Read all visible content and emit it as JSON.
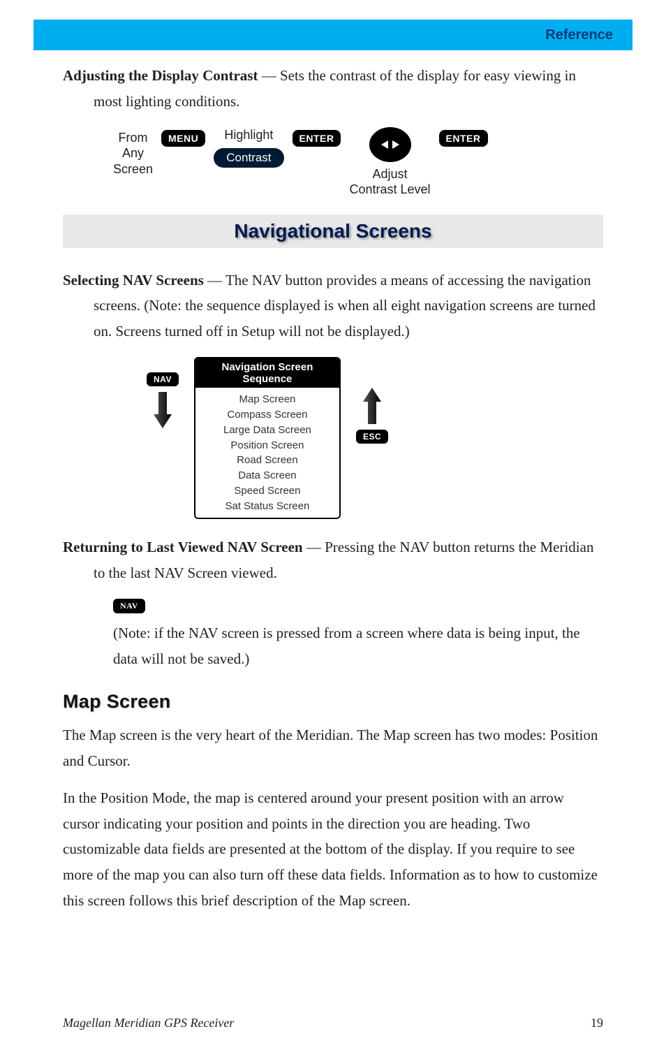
{
  "header": {
    "title": "Reference"
  },
  "section1": {
    "lead": "Adjusting the Display Contrast",
    "text": " — Sets the contrast of the display for easy viewing in most lighting conditions.",
    "flow": {
      "from_l1": "From",
      "from_l2": "Any",
      "from_l3": "Screen",
      "menu": "MENU",
      "highlight": "Highlight",
      "contrast": "Contrast",
      "enter": "ENTER",
      "adjust_l1": "Adjust",
      "adjust_l2": "Contrast Level"
    }
  },
  "nav_header": "Navigational Screens",
  "section2": {
    "lead": "Selecting NAV Screens",
    "text": " — The NAV button provides a means of accessing the navigation screens. (Note: the sequence displayed is when all eight navigation screens are turned on. Screens turned off in Setup will not be displayed.)",
    "nav": "NAV",
    "esc": "ESC",
    "seq_title_l1": "Navigation Screen",
    "seq_title_l2": "Sequence",
    "items": [
      "Map Screen",
      "Compass Screen",
      "Large Data Screen",
      "Position Screen",
      "Road Screen",
      "Data Screen",
      "Speed Screen",
      "Sat Status Screen"
    ]
  },
  "section3": {
    "lead": "Returning to Last Viewed NAV Screen",
    "text": " — Pressing the NAV button returns the Meridian to the last NAV Screen viewed.",
    "nav": "NAV",
    "note": "(Note: if the NAV screen is pressed from a screen where data is being input, the data will not be saved.)"
  },
  "map": {
    "heading": "Map Screen",
    "p1": "The Map screen is the very heart of the Meridian. The Map screen has two modes: Position and Cursor.",
    "p2": "In the Position Mode, the map is centered around your present position with an arrow cursor indicating your position and points in the direction you are heading. Two customizable data fields are presented at the bottom of the display. If you require to see more of the map you can also turn off these data fields. Information as to how to customize this screen follows this brief description of the Map screen."
  },
  "footer": {
    "title": "Magellan Meridian GPS Receiver",
    "page": "19"
  }
}
